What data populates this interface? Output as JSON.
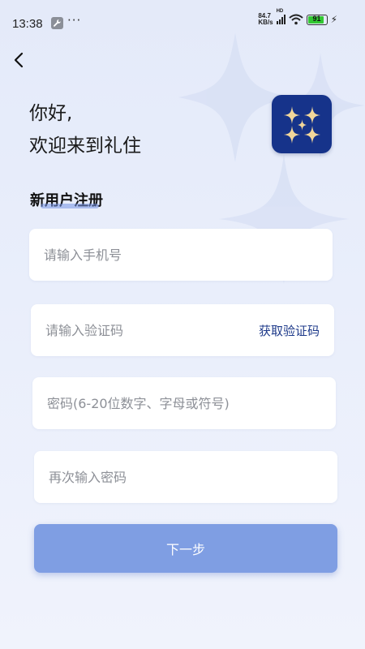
{
  "status_bar": {
    "time": "13:38",
    "more": "···",
    "net_speed_value": "84.7",
    "net_speed_unit": "KB/s",
    "network_badge": "HD",
    "battery_level": "91",
    "icons": [
      "wrench-icon",
      "signal-icon",
      "wifi-icon",
      "battery-icon",
      "charging-icon"
    ]
  },
  "header": {
    "back_icon": "chevron-left-icon",
    "greeting_line1": "你好,",
    "greeting_line2": "欢迎来到礼住",
    "logo_icon": "sparkle-logo"
  },
  "form": {
    "title": "新用户注册",
    "phone_placeholder": "请输入手机号",
    "code_placeholder": "请输入验证码",
    "get_code_label": "获取验证码",
    "password_placeholder": "密码(6-20位数字、字母或符号)",
    "confirm_placeholder": "再次输入密码",
    "next_label": "下一步"
  },
  "colors": {
    "accent": "#1e3a8a",
    "button": "#7f9ee3",
    "logo_bg": "#16338a",
    "star": "#f2d79a"
  }
}
